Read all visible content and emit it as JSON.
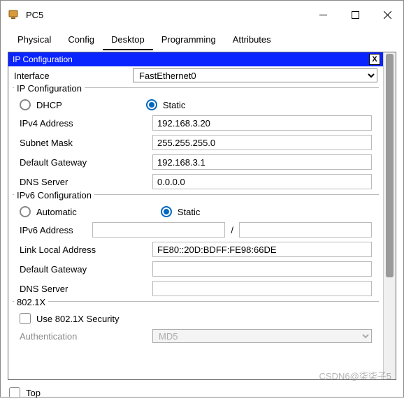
{
  "window": {
    "title": "PC5"
  },
  "tabs": {
    "physical": "Physical",
    "config": "Config",
    "desktop": "Desktop",
    "programming": "Programming",
    "attributes": "Attributes"
  },
  "panel": {
    "title": "IP Configuration",
    "close": "X"
  },
  "interface": {
    "label": "Interface",
    "value": "FastEthernet0"
  },
  "ipv4": {
    "group": "IP Configuration",
    "dhcp": "DHCP",
    "static": "Static",
    "addr_label": "IPv4 Address",
    "addr": "192.168.3.20",
    "mask_label": "Subnet Mask",
    "mask": "255.255.255.0",
    "gw_label": "Default Gateway",
    "gw": "192.168.3.1",
    "dns_label": "DNS Server",
    "dns": "0.0.0.0"
  },
  "ipv6": {
    "group": "IPv6 Configuration",
    "auto": "Automatic",
    "static": "Static",
    "addr_label": "IPv6 Address",
    "addr": "",
    "prefix": "",
    "lla_label": "Link Local Address",
    "lla": "FE80::20D:BDFF:FE98:66DE",
    "gw_label": "Default Gateway",
    "gw": "",
    "dns_label": "DNS Server",
    "dns": "",
    "slash": "/"
  },
  "dot1x": {
    "group": "802.1X",
    "use": "Use 802.1X Security",
    "auth_label": "Authentication",
    "auth": "MD5"
  },
  "footer": {
    "top": "Top"
  },
  "watermark": "CSDN6@柒柒子5"
}
